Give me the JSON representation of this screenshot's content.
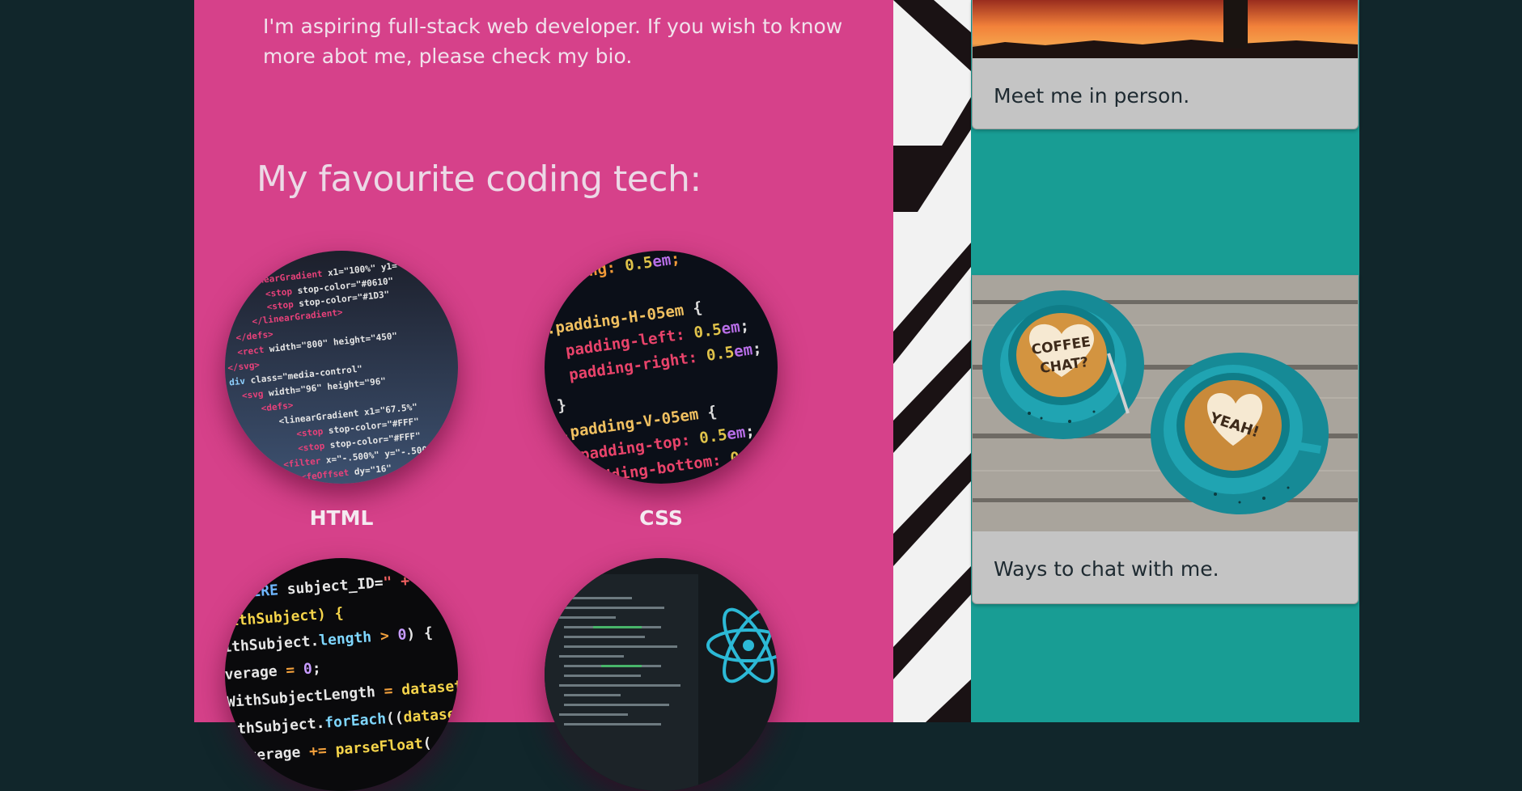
{
  "intro": {
    "text": "I'm aspiring full-stack web developer. If you wish to know more abot me, please check my bio."
  },
  "tech": {
    "title": "My favourite coding tech:",
    "items": [
      {
        "label": "HTML",
        "image": "html-code-image"
      },
      {
        "label": "CSS",
        "image": "css-code-image"
      },
      {
        "label": "",
        "image": "javascript-code-image"
      },
      {
        "label": "",
        "image": "react-code-image"
      }
    ]
  },
  "sidebar": {
    "cards": [
      {
        "text": "Meet me in person.",
        "image": "sunset-image"
      },
      {
        "text": "Ways to chat with me.",
        "image": "coffee-cups-image"
      }
    ],
    "coffee_cup_texts": [
      "COFFEE",
      "CHAT?",
      "YEAH!"
    ]
  },
  "colors": {
    "page_background": "#11262b",
    "main_panel": "#d6418a",
    "sidebar_panel": "#189d94",
    "card_background": "#c4c4c4"
  }
}
